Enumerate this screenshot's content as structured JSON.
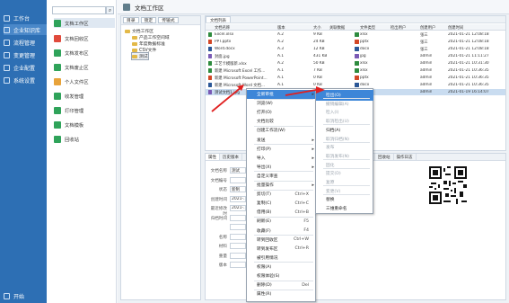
{
  "sidebar": {
    "items": [
      "工作台",
      "企业知识库",
      "流程管理",
      "变更管理",
      "企业配置",
      "系统设置"
    ],
    "start": "开始"
  },
  "menu": {
    "items": [
      "文档工作区",
      "文档回收区",
      "文档发布区",
      "文档废止区",
      "个人文件区",
      "收发管理",
      "打印管理",
      "文档模板",
      "回收站"
    ]
  },
  "window": {
    "title": "文档工作区"
  },
  "tree": {
    "toolbar": [
      "目录",
      "锁定",
      "传输式"
    ],
    "root": "文档工作区",
    "nodes": [
      "产品工作空间域",
      "年度数据标准",
      "CSV文件",
      "测试"
    ]
  },
  "list": {
    "tab": "文档列表",
    "headers": [
      "文档名称",
      "版本",
      "大小",
      "关联数据",
      "文件类型",
      "检出用户",
      "创建用户",
      "创建时间"
    ],
    "rows": [
      [
        "Excel.xlsx",
        "A.2",
        "9 KB",
        "",
        "xlsx",
        "",
        "张三",
        "2021-01-21 12:08:18"
      ],
      [
        "PPT.pptx",
        "A.2",
        "24 KB",
        "",
        "pptx",
        "",
        "张三",
        "2021-01-21 12:08:18"
      ],
      [
        "Word.docx",
        "A.3",
        "12 KB",
        "",
        "docx",
        "",
        "张三",
        "2021-01-21 12:08:18"
      ],
      [
        "封面.jpg",
        "A.1",
        "431 KB",
        "",
        "jpg",
        "",
        "admin",
        "2021-01-21 11:11:27"
      ],
      [
        "工艺卡模版新.xlsx",
        "A.2",
        "50 KB",
        "",
        "xlsx",
        "",
        "admin",
        "2021-01-21 10:31:30"
      ],
      [
        "新建 Microsoft Excel 工作...",
        "A.1",
        "7 KB",
        "",
        "xlsx",
        "",
        "admin",
        "2021-01-21 10:36:35"
      ],
      [
        "新建 Microsoft PowerPoint...",
        "A.1",
        "0 KB",
        "",
        "pptx",
        "",
        "admin",
        "2021-01-21 10:36:35"
      ],
      [
        "新建 Microsoft Word 文档...",
        "A.1",
        "0 KB",
        "",
        "docx",
        "",
        "admin",
        "2021-01-21 10:36:35"
      ],
      [
        "测试文档1.jpg",
        "A.1",
        "1124 KB",
        "",
        "jpg",
        "",
        "admin",
        "2021-01-19 16:14:07"
      ]
    ]
  },
  "detail": {
    "tabs": [
      "属性",
      "历史版本",
      "",
      "",
      "",
      "",
      "",
      "",
      "",
      "流程记录",
      "使用记录",
      "回收站",
      "操作日志"
    ],
    "fields": [
      "文档名称",
      "文档编号",
      "状态",
      "创建时间",
      "最近修改时",
      "归档时间",
      "",
      "名称",
      "材料",
      "重量",
      "版本"
    ],
    "values": [
      "测试",
      "",
      "新制",
      "2021-...",
      "2021-...",
      "",
      "",
      "",
      "",
      "",
      ""
    ]
  },
  "context_menu": {
    "items": [
      {
        "label": "全新审批",
        "shortcut": "",
        "arrow": "▸"
      },
      {
        "label": "浏览(W)",
        "shortcut": "",
        "arrow": ""
      },
      {
        "label": "打开(O)",
        "shortcut": "",
        "arrow": ""
      },
      {
        "label": "文档比较",
        "shortcut": "",
        "arrow": ""
      },
      {
        "label": "创建工作流(W)",
        "shortcut": "",
        "arrow": ""
      },
      {
        "label": "发送",
        "shortcut": "",
        "arrow": "▸"
      },
      {
        "label": "打印(P)",
        "shortcut": "",
        "arrow": "▸"
      },
      {
        "label": "导入",
        "shortcut": "",
        "arrow": "▸"
      },
      {
        "label": "导出(X)",
        "shortcut": "",
        "arrow": "▸"
      },
      {
        "label": "自定义审查",
        "shortcut": "",
        "arrow": ""
      },
      {
        "label": "批量操作",
        "shortcut": "",
        "arrow": "▸"
      },
      {
        "label": "剪切(T)",
        "shortcut": "Ctrl+X",
        "arrow": ""
      },
      {
        "label": "复制(C)",
        "shortcut": "Ctrl+C",
        "arrow": ""
      },
      {
        "label": "借用(B)",
        "shortcut": "Ctrl+B",
        "arrow": ""
      },
      {
        "label": "刷新(E)",
        "shortcut": "F5",
        "arrow": ""
      },
      {
        "label": "收藏(F)",
        "shortcut": "F4",
        "arrow": ""
      },
      {
        "label": "转到回收区",
        "shortcut": "Ctrl+W",
        "arrow": ""
      },
      {
        "label": "转到发布区",
        "shortcut": "Ctrl+R",
        "arrow": ""
      },
      {
        "label": "被引用情况",
        "shortcut": "",
        "arrow": ""
      },
      {
        "label": "权限(A)",
        "shortcut": "",
        "arrow": ""
      },
      {
        "label": "权限体验(S)",
        "shortcut": "",
        "arrow": ""
      },
      {
        "label": "删除(D)",
        "shortcut": "Del",
        "arrow": ""
      },
      {
        "label": "属性(R)",
        "shortcut": "",
        "arrow": ""
      }
    ]
  },
  "submenu": {
    "items": [
      {
        "label": "检出(O)",
        "enabled": true
      },
      {
        "label": "撤销编辑(A)",
        "enabled": false
      },
      {
        "label": "检入(I)",
        "enabled": false
      },
      {
        "label": "取消检出(U)",
        "enabled": false
      },
      {
        "label": "归档(A)",
        "enabled": true
      },
      {
        "label": "取消归档(N)",
        "enabled": false
      },
      {
        "label": "发布",
        "enabled": false
      },
      {
        "label": "取消发布(N)",
        "enabled": false
      },
      {
        "label": "固化",
        "enabled": false
      },
      {
        "label": "提交(D)",
        "enabled": false
      },
      {
        "label": "复原",
        "enabled": false
      },
      {
        "label": "变更(V)",
        "enabled": false
      },
      {
        "label": "替换",
        "enabled": true
      },
      {
        "label": "三维重命名",
        "enabled": true
      }
    ]
  }
}
